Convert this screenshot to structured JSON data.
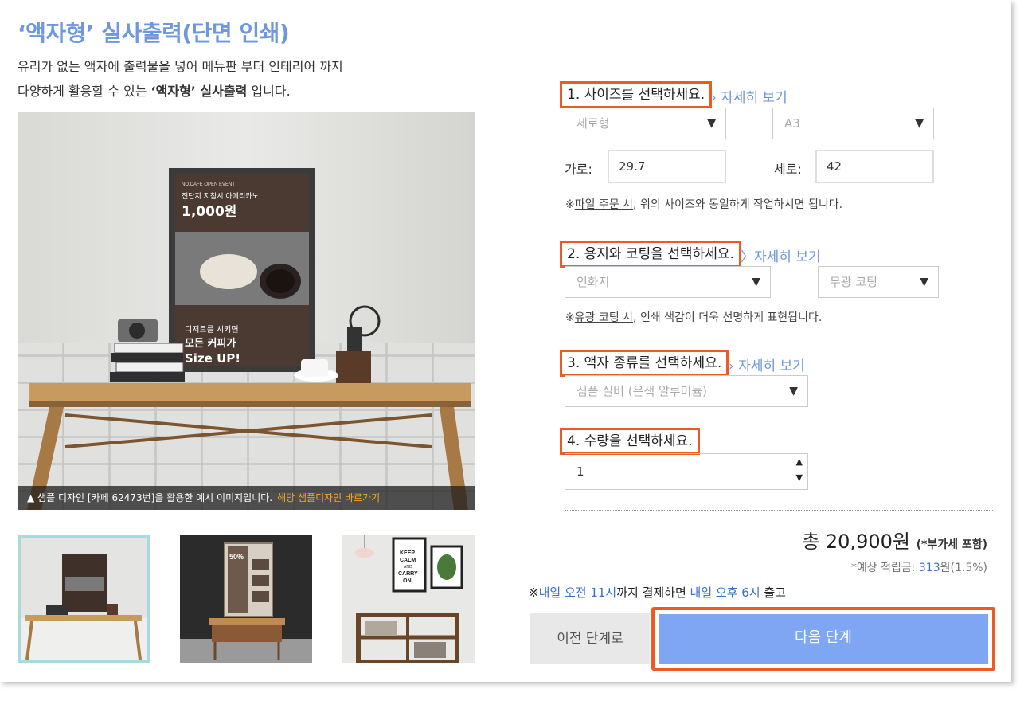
{
  "header": {
    "title": "‘액자형’ 실사출력(단면 인쇄)",
    "desc_line1_underlined": "유리가 없는 액자",
    "desc_line1_rest": "에 출력물을 넣어 메뉴판 부터 인테리어 까지",
    "desc_line2_pre": "다양하게 활용할 수 있는 ",
    "desc_line2_bold": "‘액자형’ 실사출력",
    "desc_line2_post": " 입니다."
  },
  "main_image": {
    "poster_event": "NO.CAFE OPEN EVENT",
    "poster_headline": "전단지 지참시 아메리카노",
    "poster_price": "1,000원",
    "poster_promo1": "디저트를 시키면",
    "poster_promo2": "모든 커피가",
    "poster_promo3": "Size UP!",
    "caption_text": "▲ 샘플 디자인 [카페 62473번]을 활용한 예시 이미지입니다.",
    "caption_link": "해당 샘플디자인 바로가기"
  },
  "thumbnails": [
    {
      "name": "thumb-1"
    },
    {
      "name": "thumb-2",
      "poster_text": "50%"
    },
    {
      "name": "thumb-3",
      "poster_line1": "KEEP",
      "poster_line2": "CALM",
      "poster_line3": "AND",
      "poster_line4": "CARRY",
      "poster_line5": "ON"
    }
  ],
  "step1": {
    "label": "1. 사이즈를 선택하세요.",
    "detail": "› 자세히 보기",
    "orientation": "세로형",
    "size": "A3",
    "width_label": "가로:",
    "width_value": "29.7",
    "height_label": "세로:",
    "height_value": "42",
    "note_pre": "※",
    "note_link": "파일 주문 시",
    "note_post": ", 위의 사이즈와 동일하게 작업하시면 됩니다."
  },
  "step2": {
    "label": "2. 용지와 코팅을 선택하세요.",
    "detail": "〉자세히 보기",
    "paper": "인화지",
    "coating": "무광 코팅",
    "note_pre": "※",
    "note_link": "유광 코팅 시",
    "note_post": ", 인쇄 색감이 더욱 선명하게 표현됩니다."
  },
  "step3": {
    "label": "3. 액자 종류를 선택하세요.",
    "detail": "› 자세히 보기",
    "frame": "심플 실버 (은색 알루미늄)"
  },
  "step4": {
    "label": "4. 수량을 선택하세요.",
    "quantity": "1",
    "up": "▲",
    "down": "▼"
  },
  "summary": {
    "total": "총 20,900원",
    "vat": "(*부가세 포함)",
    "points_pre": "*예상 적립금: ",
    "points_value": "313",
    "points_post": "원(1.5%)",
    "ship_mark": "※",
    "ship_blue1": "내일 오전 11시",
    "ship_mid": "까지 결제하면 ",
    "ship_blue2": "내일 오후 6시",
    "ship_post": " 출고"
  },
  "buttons": {
    "prev": "이전 단계로",
    "next": "다음 단계"
  },
  "icons": {
    "dropdown": "▼"
  },
  "colors": {
    "accent": "#6f97e0",
    "highlight_border": "#ee5a24",
    "next_button": "#7ea6f2",
    "link_blue": "#3a6fc8"
  }
}
